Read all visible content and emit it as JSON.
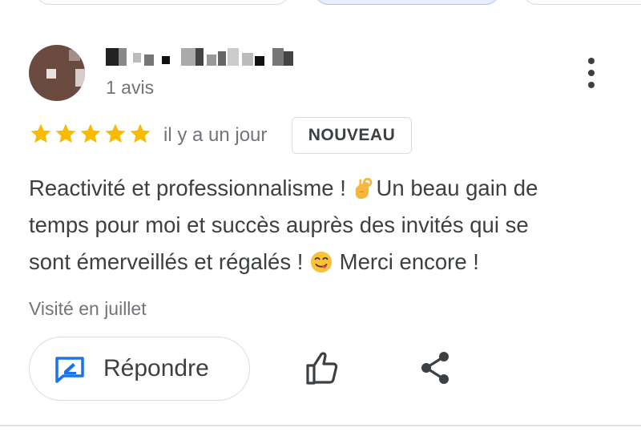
{
  "review": {
    "reviewer_count": "1 avis",
    "rating": 5,
    "rating_max": 5,
    "relative_time": "il y a un jour",
    "badge": "NOUVEAU",
    "text_lines": [
      "Reactivité et professionnalisme ! ",
      "Un beau gain de",
      "temps pour moi et succès auprès des invités qui se",
      "sont émerveillés et régalés ! ",
      " Merci encore !"
    ],
    "visit": "Visité en juillet"
  },
  "actions": {
    "reply_label": "Répondre"
  },
  "icons": {
    "reply": "edit-reply-icon",
    "like": "thumbs-up-icon",
    "share": "share-icon",
    "more": "more-vertical-icon",
    "emoji_1": "ok-hand-emoji",
    "emoji_2": "savoring-face-emoji"
  },
  "colors": {
    "star": "#f9bb00",
    "reply_icon": "#1a73e8",
    "text": "#3c4043",
    "secondary_text": "#70757a",
    "avatar": "#6b4a3f"
  }
}
